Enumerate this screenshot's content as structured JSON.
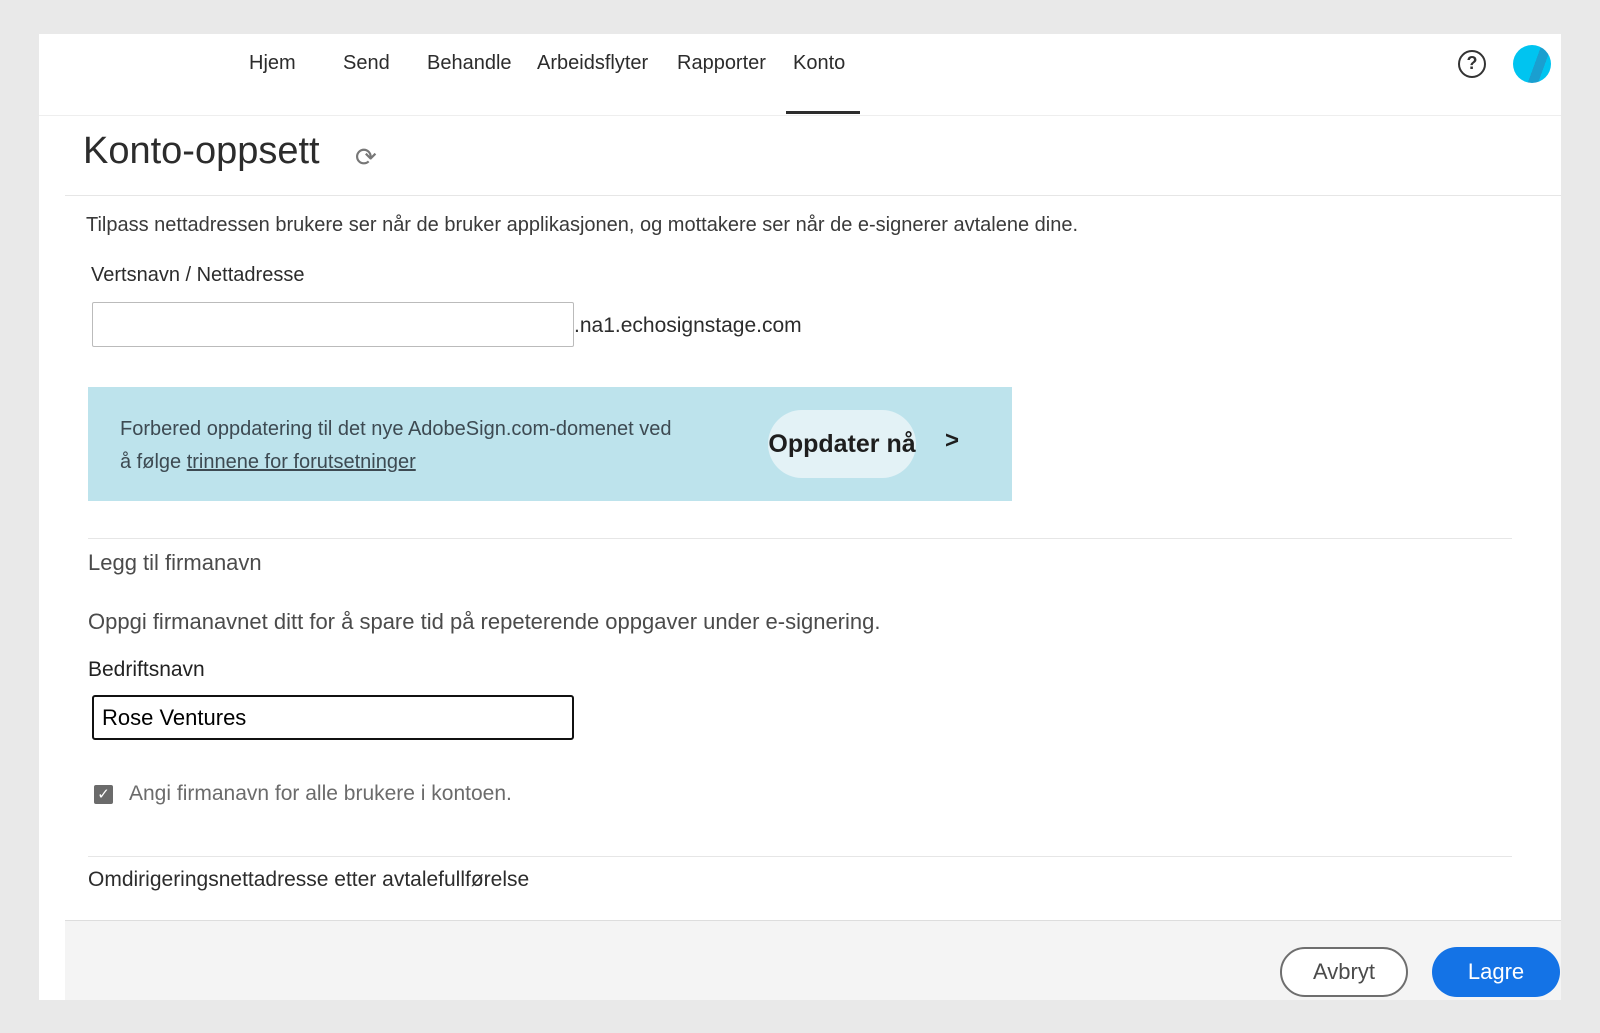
{
  "nav": {
    "items": [
      "Hjem",
      "Send",
      "Behandle",
      "Arbeidsflyter",
      "Rapporter",
      "Konto"
    ],
    "active": "Konto",
    "help_icon": "help-circle-icon",
    "avatar": "user-avatar"
  },
  "page": {
    "title": "Konto-oppsett",
    "refresh_icon": "refresh-icon"
  },
  "hostname": {
    "description": "Tilpass nettadressen brukere ser når de bruker applikasjonen, og mottakere ser når de e-signerer avtalene dine.",
    "label": "Vertsnavn / Nettadresse",
    "value": "",
    "suffix": ".na1.echosignstage.com"
  },
  "banner": {
    "text": "Forbered oppdatering til det nye AdobeSign.com-domenet ved",
    "text2": "å følge ",
    "link": "trinnene for forutsetninger",
    "button": "Oppdater nå",
    "arrow": ">",
    "color": "#bde3ec"
  },
  "company": {
    "heading": "Legg til firmanavn",
    "description": "Oppgi firmanavnet ditt for å spare tid på repeterende oppgaver under e-signering.",
    "label": "Bedriftsnavn",
    "value": "Rose Ventures",
    "checkbox_label": "Angi firmanavn for alle brukere i kontoen.",
    "checkbox_checked": true
  },
  "redirect": {
    "heading": "Omdirigeringsnettadresse etter avtalefullførelse"
  },
  "footer": {
    "cancel": "Avbryt",
    "save": "Lagre",
    "save_color": "#1473e6"
  }
}
